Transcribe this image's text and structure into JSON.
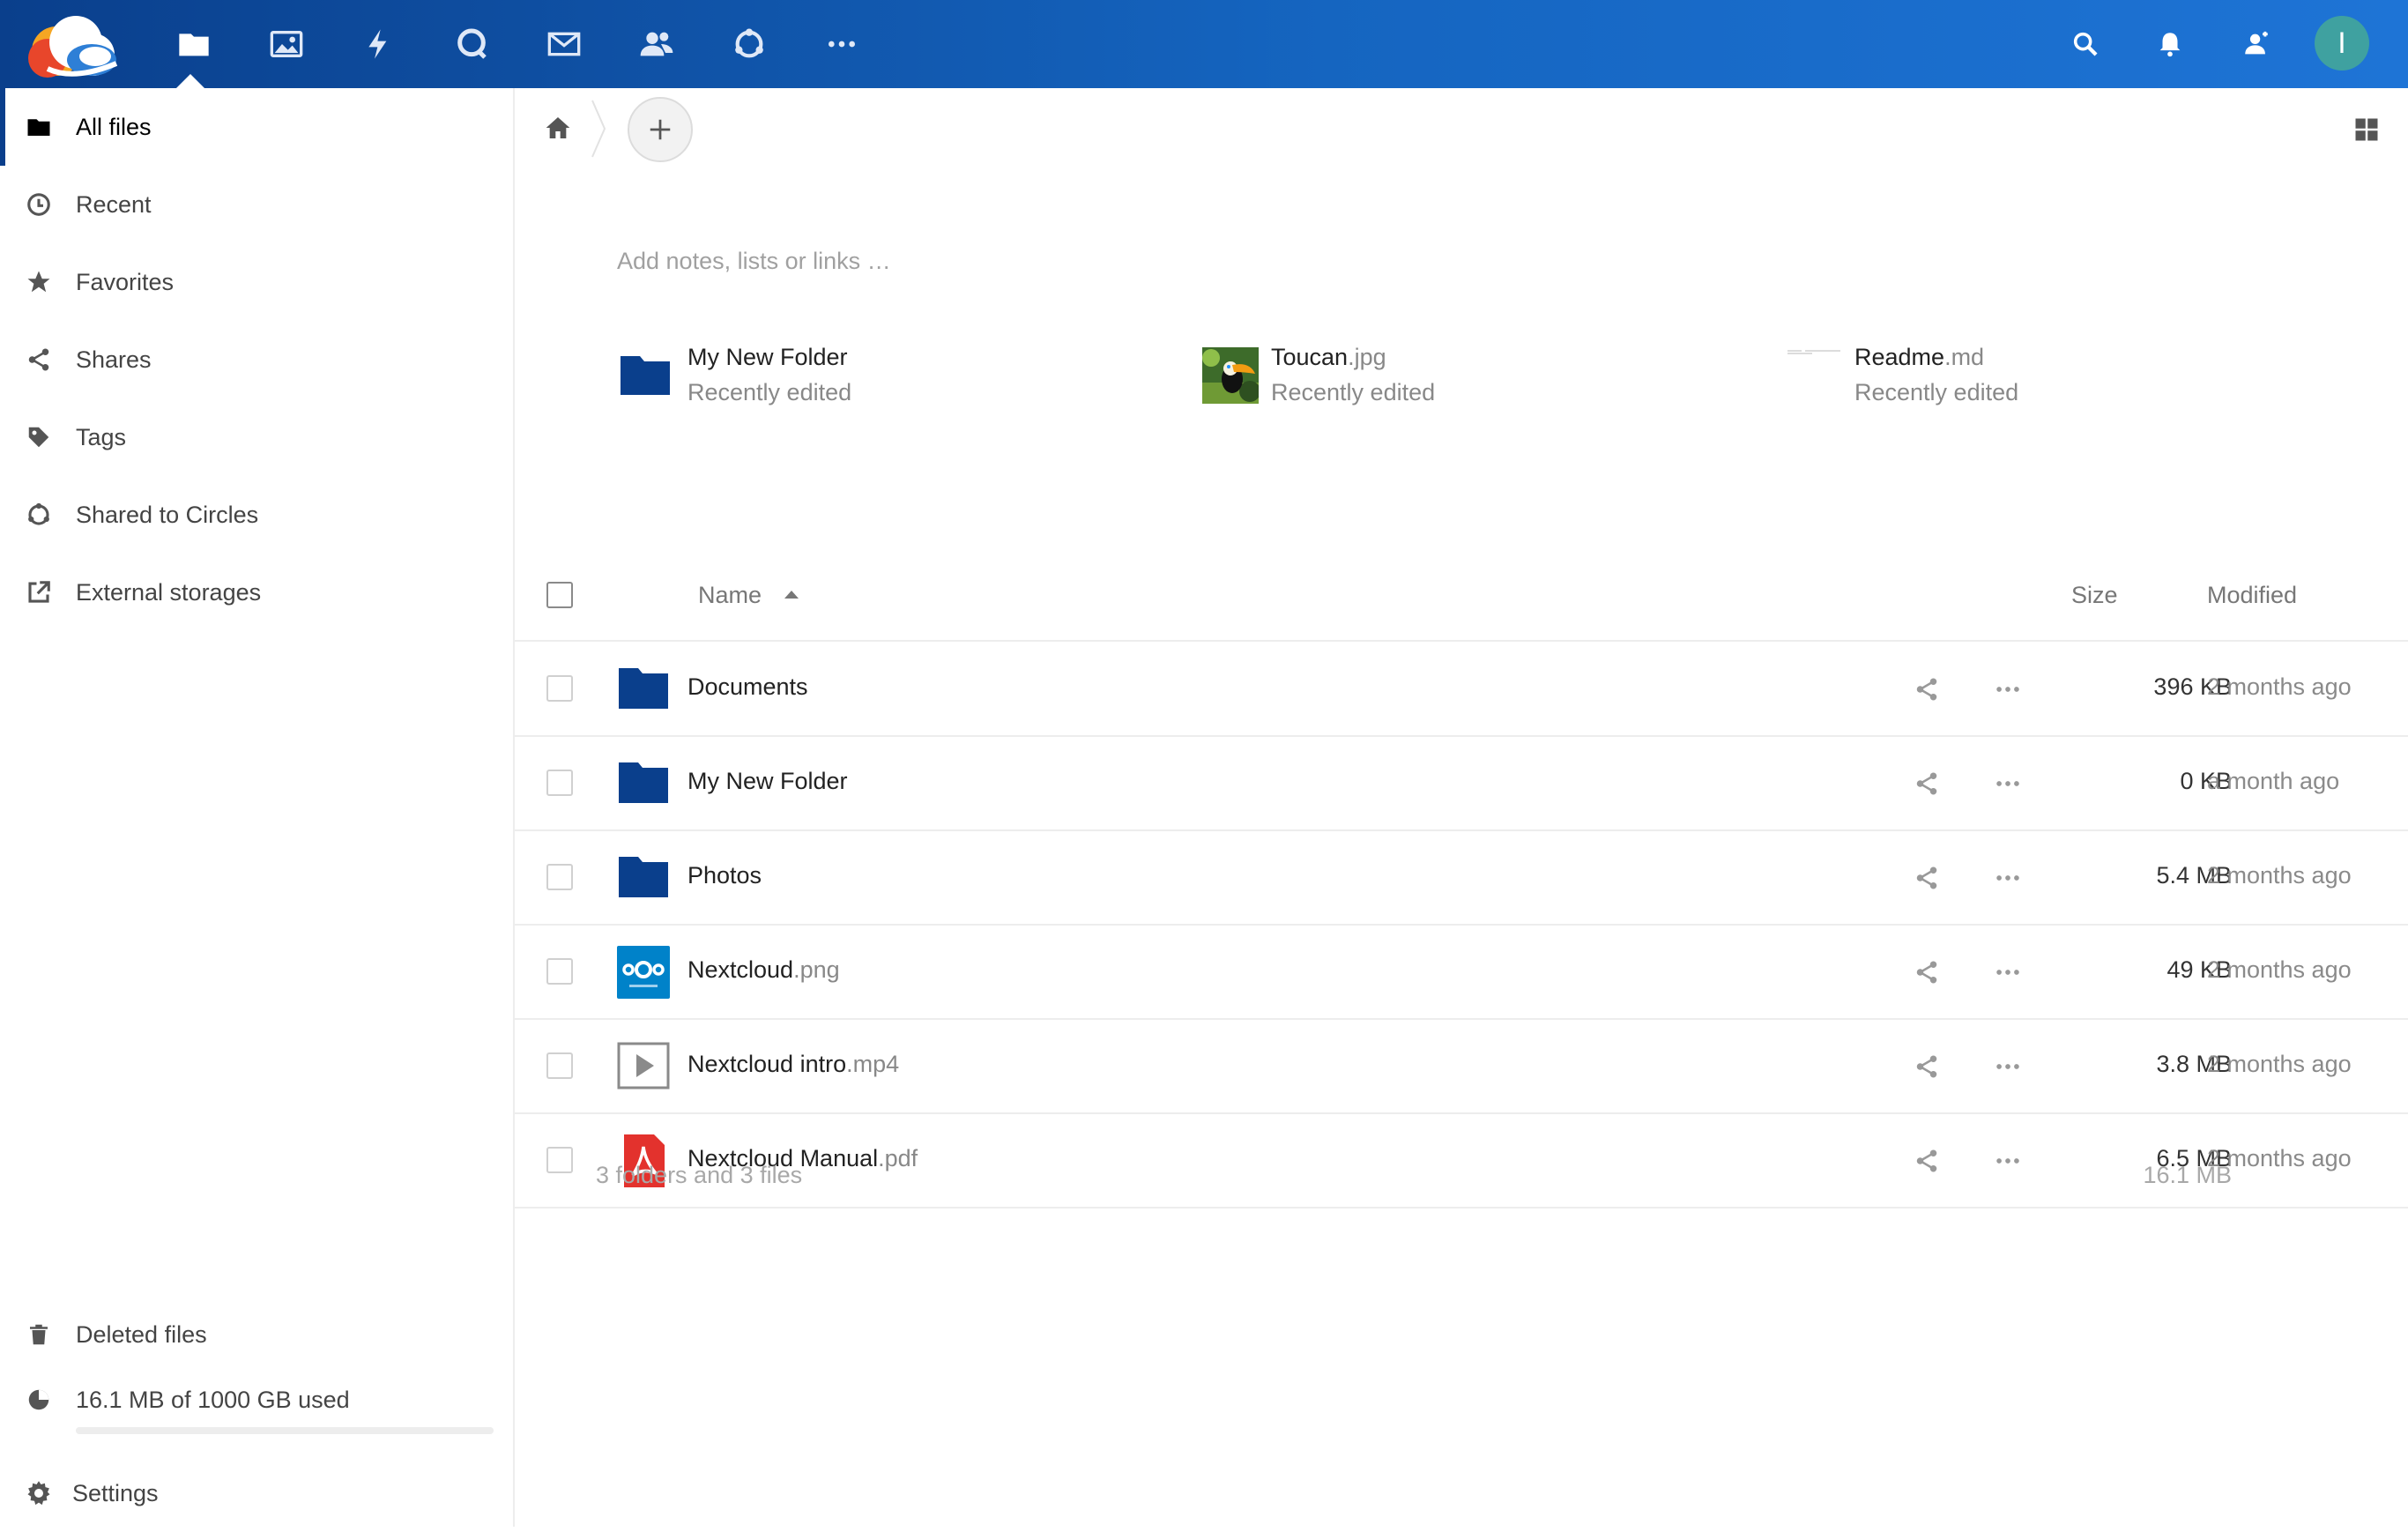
{
  "colors": {
    "header": "#0a3f8c",
    "folder": "#0a3f8c",
    "avatar": "#3fa1a0",
    "pdf": "#e3322d",
    "nextcloud_blue": "#0082c9"
  },
  "header": {
    "apps": [
      {
        "name": "files",
        "icon": "folder-icon",
        "active": true
      },
      {
        "name": "photos",
        "icon": "image-icon"
      },
      {
        "name": "activity",
        "icon": "lightning-icon"
      },
      {
        "name": "talk",
        "icon": "talk-icon"
      },
      {
        "name": "mail",
        "icon": "mail-icon"
      },
      {
        "name": "contacts",
        "icon": "contacts-icon"
      },
      {
        "name": "circles",
        "icon": "circles-icon"
      },
      {
        "name": "more apps",
        "icon": "more-icon"
      }
    ],
    "right_icons": [
      "search-icon",
      "bell-icon",
      "contacts-icon"
    ],
    "avatar_initial": "I"
  },
  "sidebar": {
    "items": [
      {
        "label": "All files",
        "icon": "folder-icon",
        "active": true
      },
      {
        "label": "Recent",
        "icon": "clock-icon"
      },
      {
        "label": "Favorites",
        "icon": "star-icon"
      },
      {
        "label": "Shares",
        "icon": "share-icon"
      },
      {
        "label": "Tags",
        "icon": "tag-icon"
      },
      {
        "label": "Shared to Circles",
        "icon": "circles-icon"
      },
      {
        "label": "External storages",
        "icon": "external-link-icon"
      }
    ],
    "deleted_label": "Deleted files",
    "quota_label": "16.1 MB of 1000 GB used",
    "quota_fraction": 2e-05,
    "settings_label": "Settings"
  },
  "main": {
    "notes_placeholder": "Add notes, lists or links …",
    "recent": [
      {
        "name": "My New Folder",
        "ext": "",
        "sub": "Recently edited",
        "icon": "folder-icon"
      },
      {
        "name": "Toucan",
        "ext": ".jpg",
        "sub": "Recently edited",
        "icon": "image-thumbnail"
      },
      {
        "name": "Readme",
        "ext": ".md",
        "sub": "Recently edited",
        "icon": "text-thumbnail"
      }
    ],
    "table": {
      "col_name": "Name",
      "col_size": "Size",
      "col_modified": "Modified",
      "rows": [
        {
          "name": "Documents",
          "ext": "",
          "size": "396 KB",
          "modified": "2 months ago",
          "icon": "folder-icon"
        },
        {
          "name": "My New Folder",
          "ext": "",
          "size": "0 KB",
          "modified": "a month ago",
          "icon": "folder-icon"
        },
        {
          "name": "Photos",
          "ext": "",
          "size": "5.4 MB",
          "modified": "2 months ago",
          "icon": "folder-icon"
        },
        {
          "name": "Nextcloud",
          "ext": ".png",
          "size": "49 KB",
          "modified": "2 months ago",
          "icon": "nextcloud-image-icon"
        },
        {
          "name": "Nextcloud intro",
          "ext": ".mp4",
          "size": "3.8 MB",
          "modified": "2 months ago",
          "icon": "video-icon"
        },
        {
          "name": "Nextcloud Manual",
          "ext": ".pdf",
          "size": "6.5 MB",
          "modified": "2 months ago",
          "icon": "pdf-icon"
        }
      ],
      "summary": "3 folders and 3 files",
      "summary_size": "16.1 MB"
    }
  }
}
